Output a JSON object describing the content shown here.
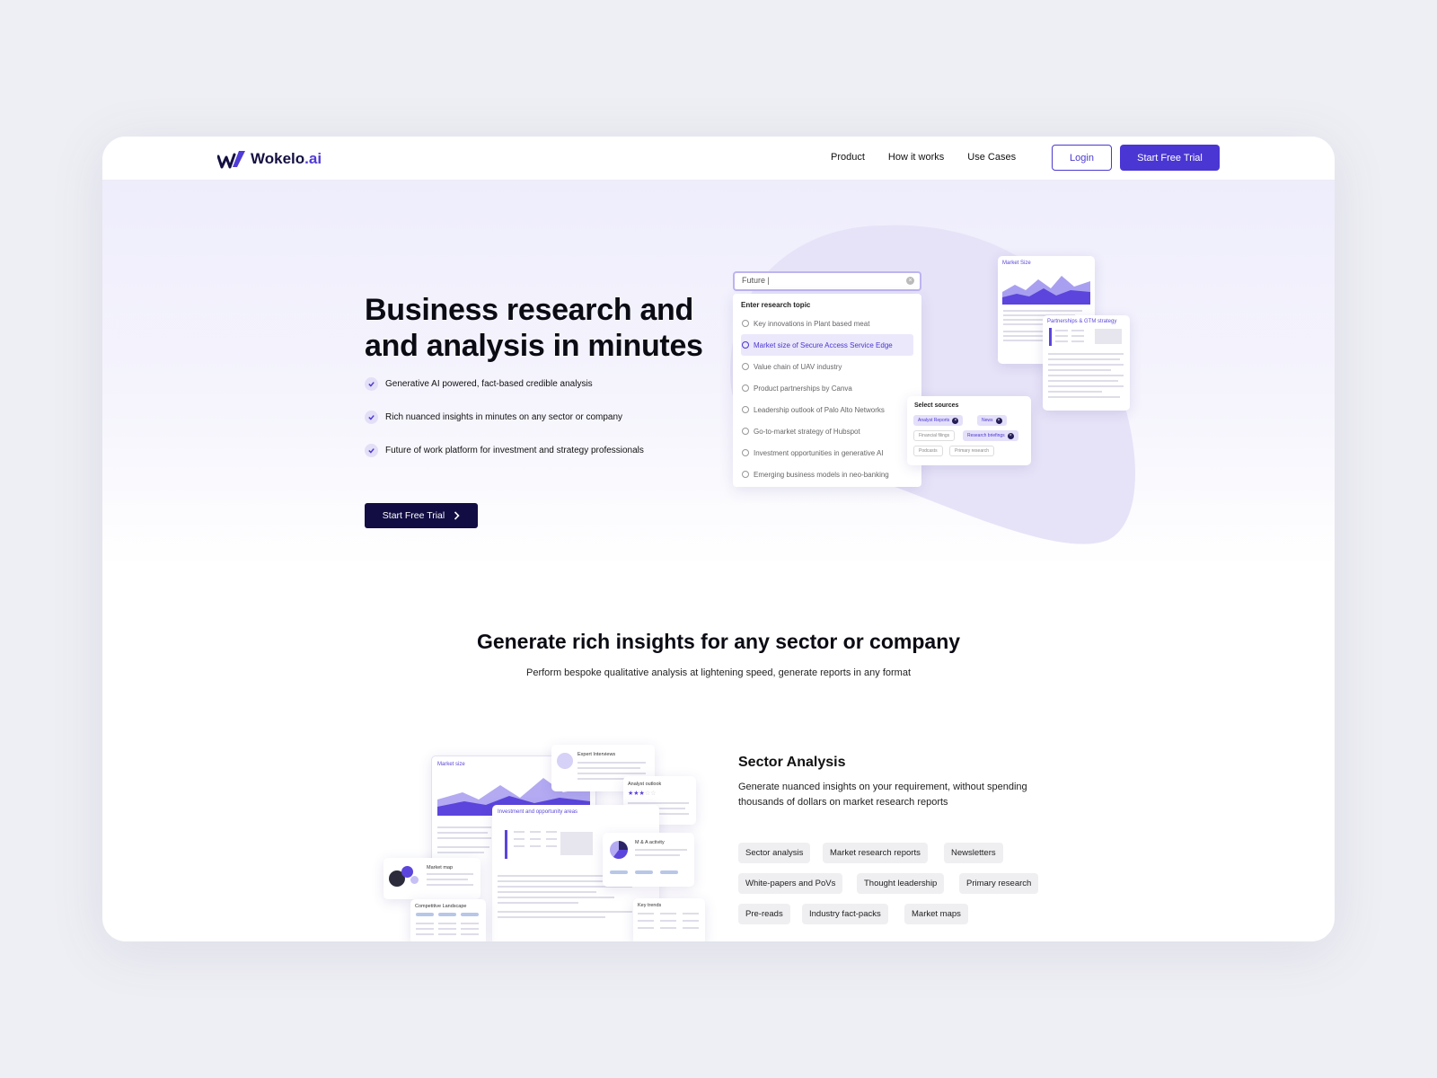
{
  "brand": {
    "name_main": "Wokelo",
    "name_suffix": ".ai",
    "accent": "#4a36d2",
    "dark": "#120d43"
  },
  "nav": {
    "links": [
      "Product",
      "How it works",
      "Use Cases"
    ],
    "login_label": "Login",
    "trial_label": "Start Free Trial"
  },
  "hero": {
    "title": "Business research and and analysis in minutes",
    "features": [
      "Generative AI powered, fact-based credible analysis",
      "Rich nuanced insights in minutes on any sector or company",
      "Future of work platform for investment and strategy professionals"
    ],
    "cta_label": "Start Free Trial"
  },
  "search": {
    "value": "Future |",
    "dropdown_header": "Enter research topic",
    "suggestions": [
      "Key innovations in Plant based meat",
      "Market size of Secure Access Service Edge",
      "Value chain of UAV industry",
      "Product partnerships by Canva",
      "Leadership outlook of Palo Alto Networks",
      "Go-to-market strategy of Hubspot",
      "Investment opportunities in generative AI",
      "Emerging business models in neo-banking"
    ],
    "active_index": 1
  },
  "preview_cards": {
    "market_size": "Market Size",
    "partnerships": "Partnerships & GTM strategy",
    "sources_title": "Select sources",
    "sources": [
      {
        "label": "Analyst Reports",
        "selected": true
      },
      {
        "label": "News",
        "selected": true
      },
      {
        "label": "Financial filings",
        "selected": false
      },
      {
        "label": "Research briefings",
        "selected": true
      },
      {
        "label": "Podcasts",
        "selected": false
      },
      {
        "label": "Primary research",
        "selected": false
      }
    ]
  },
  "section": {
    "title": "Generate rich insights for any sector or company",
    "subtitle": "Perform bespoke qualitative analysis at lightening speed, generate reports in any format"
  },
  "collage": {
    "market_size": "Market size",
    "expert_interviews": "Expert Interviews",
    "analyst_outlook": "Analyst outlook",
    "investment_areas": "Investment and opportunity areas",
    "market_map": "Market map",
    "ma_activity": "M & A activity",
    "competitive_landscape": "Competitive Landscape",
    "key_trends": "Key trends"
  },
  "feature_block": {
    "title": "Sector Analysis",
    "description": "Generate nuanced insights on your requirement, without spending thousands of dollars on market research reports",
    "tags": [
      "Sector analysis",
      "Market research reports",
      "Newsletters",
      "White-papers and PoVs",
      "Thought leadership",
      "Primary research",
      "Pre-reads",
      "Industry fact-packs",
      "Market maps"
    ]
  }
}
